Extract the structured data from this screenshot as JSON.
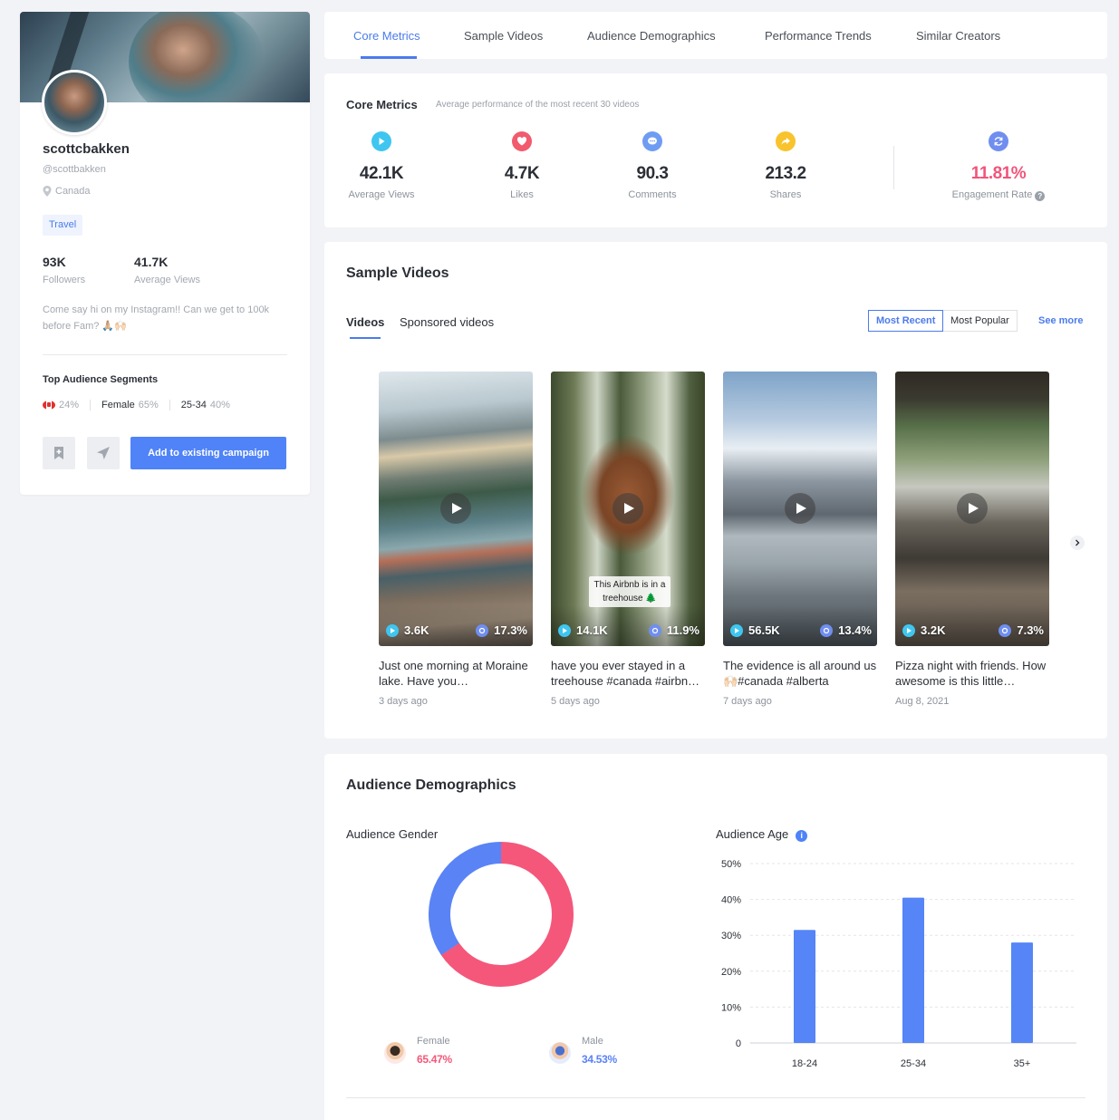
{
  "profile": {
    "username": "scottcbakken",
    "handle": "@scottbakken",
    "location": "Canada",
    "tag": "Travel",
    "followers": {
      "value": "93K",
      "label": "Followers"
    },
    "avg_views": {
      "value": "41.7K",
      "label": "Average Views"
    },
    "bio": "Come say hi on my Instagram!! Can we get to 100k before Fam? 🙏🏼🙌🏻",
    "segments_title": "Top Audience Segments",
    "segments": {
      "country_pct": "24%",
      "gender": "Female",
      "gender_pct": "65%",
      "age": "25-34",
      "age_pct": "40%"
    },
    "add_campaign_label": "Add to existing campaign"
  },
  "tabs": [
    "Core Metrics",
    "Sample Videos",
    "Audience Demographics",
    "Performance Trends",
    "Similar Creators"
  ],
  "core_metrics": {
    "title": "Core Metrics",
    "subtitle": "Average performance of the most recent 30 videos",
    "items": [
      {
        "value": "42.1K",
        "label": "Average Views",
        "color": "#3ec6f0"
      },
      {
        "value": "4.7K",
        "label": "Likes",
        "color": "#f25a6e"
      },
      {
        "value": "90.3",
        "label": "Comments",
        "color": "#6f9cf3"
      },
      {
        "value": "213.2",
        "label": "Shares",
        "color": "#f8c32c"
      }
    ],
    "engagement": {
      "value": "11.81%",
      "label": "Engagement Rate",
      "color": "#f2547a",
      "icon_color": "#6f8ef0"
    }
  },
  "sample_videos": {
    "title": "Sample Videos",
    "subtabs": [
      "Videos",
      "Sponsored videos"
    ],
    "sort": [
      "Most Recent",
      "Most Popular"
    ],
    "see_more": "See more",
    "videos": [
      {
        "views": "3.6K",
        "engagement": "17.3%",
        "title": "Just one morning at Moraine lake. Have you…",
        "date": "3 days ago",
        "caption": ""
      },
      {
        "views": "14.1K",
        "engagement": "11.9%",
        "title": "have you ever stayed in a treehouse #canada #airbn…",
        "date": "5 days ago",
        "caption": "This Airbnb is in a treehouse 🌲"
      },
      {
        "views": "56.5K",
        "engagement": "13.4%",
        "title": "The evidence is all around us 🙌🏻#canada #alberta",
        "date": "7 days ago",
        "caption": ""
      },
      {
        "views": "3.2K",
        "engagement": "7.3%",
        "title": "Pizza night with friends. How awesome is this little…",
        "date": "Aug 8, 2021",
        "caption": ""
      }
    ]
  },
  "demographics": {
    "title": "Audience Demographics",
    "gender_title": "Audience Gender",
    "age_title": "Audience Age",
    "female": {
      "label": "Female",
      "value": "65.47%",
      "color": "#f4577a"
    },
    "male": {
      "label": "Male",
      "value": "34.53%",
      "color": "#5a83f5"
    }
  },
  "chart_data": {
    "type": "bar",
    "title": "Audience Age",
    "categories": [
      "18-24",
      "25-34",
      "35+"
    ],
    "values": [
      31.5,
      40.5,
      28
    ],
    "yticks": [
      "0",
      "10%",
      "20%",
      "30%",
      "40%",
      "50%"
    ],
    "ylim": [
      0,
      50
    ],
    "grid": true,
    "bar_color": "#5585f6"
  }
}
